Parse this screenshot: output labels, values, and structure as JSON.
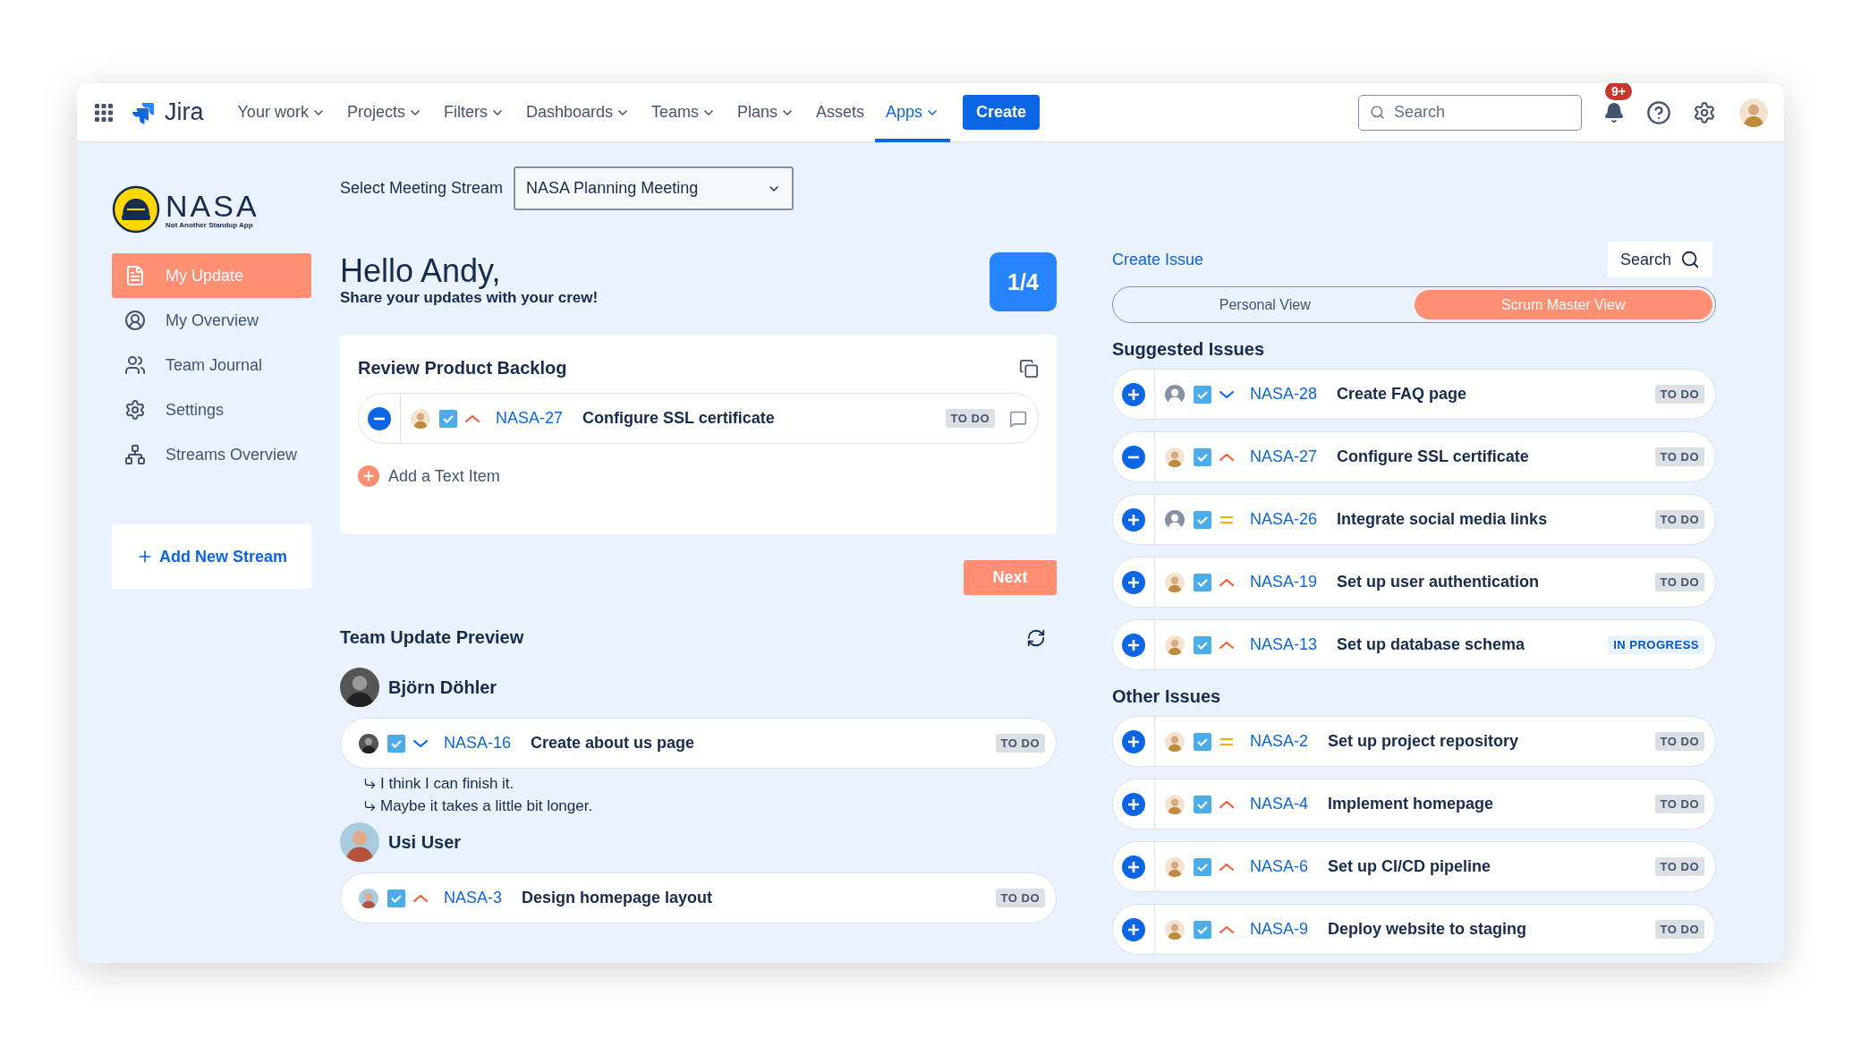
{
  "nav": {
    "product": "Jira",
    "items": [
      {
        "label": "Your work",
        "dropdown": true,
        "selected": false
      },
      {
        "label": "Projects",
        "dropdown": true,
        "selected": false
      },
      {
        "label": "Filters",
        "dropdown": true,
        "selected": false
      },
      {
        "label": "Dashboards",
        "dropdown": true,
        "selected": false
      },
      {
        "label": "Teams",
        "dropdown": true,
        "selected": false
      },
      {
        "label": "Plans",
        "dropdown": true,
        "selected": false
      },
      {
        "label": "Assets",
        "dropdown": false,
        "selected": false
      },
      {
        "label": "Apps",
        "dropdown": true,
        "selected": true
      }
    ],
    "create": "Create",
    "search": {
      "placeholder": "Search"
    },
    "notifications": "9+"
  },
  "sidebar": {
    "logo": {
      "name": "NASA",
      "tagline": "Not Another Standup App"
    },
    "items": [
      {
        "label": "My Update",
        "selected": true
      },
      {
        "label": "My Overview",
        "selected": false
      },
      {
        "label": "Team Journal",
        "selected": false
      },
      {
        "label": "Settings",
        "selected": false
      },
      {
        "label": "Streams Overview",
        "selected": false
      }
    ],
    "add_stream": "Add New Stream"
  },
  "main": {
    "stream_label": "Select Meeting Stream",
    "stream_value": "NASA Planning Meeting",
    "greeting": "Hello Andy,",
    "subtitle": "Share your updates with your crew!",
    "progress": "1/4",
    "card": {
      "title": "Review Product Backlog",
      "issues": [
        {
          "action": {
            "kind": "remove"
          },
          "avatar": {
            "kind": "person"
          },
          "priority": {
            "kind": "high"
          },
          "key": "NASA-27",
          "title": "Configure SSL certificate",
          "status": {
            "label": "TO DO",
            "kind": "todo"
          }
        }
      ],
      "add_text": "Add a Text Item"
    },
    "next": "Next",
    "preview": {
      "title": "Team Update Preview",
      "members": [
        {
          "name": "Björn Döhler",
          "avatar": {
            "kind": "dark"
          },
          "issues": [
            {
              "avatar": {
                "kind": "dark"
              },
              "priority": {
                "kind": "low"
              },
              "key": "NASA-16",
              "title": "Create about us page",
              "status": {
                "label": "TO DO",
                "kind": "todo"
              }
            }
          ],
          "notes": [
            "I think I can finish it.",
            "Maybe it takes a little bit longer."
          ]
        },
        {
          "name": "Usi User",
          "avatar": {
            "kind": "light"
          },
          "issues": [
            {
              "avatar": {
                "kind": "light"
              },
              "priority": {
                "kind": "high"
              },
              "key": "NASA-3",
              "title": "Design homepage layout",
              "status": {
                "label": "TO DO",
                "kind": "todo"
              }
            }
          ]
        }
      ]
    }
  },
  "panel": {
    "create_issue": "Create Issue",
    "search": "Search",
    "views": [
      {
        "label": "Personal View",
        "selected": false
      },
      {
        "label": "Scrum Master View",
        "selected": true
      }
    ],
    "sections": [
      {
        "title": "Suggested Issues",
        "issues": [
          {
            "action": {
              "kind": "add"
            },
            "avatar": {
              "kind": "placeholder"
            },
            "priority": {
              "kind": "low"
            },
            "key": "NASA-28",
            "title": "Create FAQ page",
            "status": {
              "label": "TO DO",
              "kind": "todo"
            }
          },
          {
            "action": {
              "kind": "remove"
            },
            "avatar": {
              "kind": "person"
            },
            "priority": {
              "kind": "high"
            },
            "key": "NASA-27",
            "title": "Configure SSL certificate",
            "status": {
              "label": "TO DO",
              "kind": "todo"
            }
          },
          {
            "action": {
              "kind": "add"
            },
            "avatar": {
              "kind": "placeholder"
            },
            "priority": {
              "kind": "medium"
            },
            "key": "NASA-26",
            "title": "Integrate social media links",
            "status": {
              "label": "TO DO",
              "kind": "todo"
            }
          },
          {
            "action": {
              "kind": "add"
            },
            "avatar": {
              "kind": "person"
            },
            "priority": {
              "kind": "high"
            },
            "key": "NASA-19",
            "title": "Set up user authentication",
            "status": {
              "label": "TO DO",
              "kind": "todo"
            }
          },
          {
            "action": {
              "kind": "add"
            },
            "avatar": {
              "kind": "person"
            },
            "priority": {
              "kind": "high"
            },
            "key": "NASA-13",
            "title": "Set up database schema",
            "status": {
              "label": "IN PROGRESS",
              "kind": "progress"
            }
          }
        ]
      },
      {
        "title": "Other Issues",
        "issues": [
          {
            "action": {
              "kind": "add"
            },
            "avatar": {
              "kind": "person"
            },
            "priority": {
              "kind": "medium"
            },
            "key": "NASA-2",
            "title": "Set up project repository",
            "status": {
              "label": "TO DO",
              "kind": "todo"
            }
          },
          {
            "action": {
              "kind": "add"
            },
            "avatar": {
              "kind": "person"
            },
            "priority": {
              "kind": "high"
            },
            "key": "NASA-4",
            "title": "Implement homepage",
            "status": {
              "label": "TO DO",
              "kind": "todo"
            }
          },
          {
            "action": {
              "kind": "add"
            },
            "avatar": {
              "kind": "person"
            },
            "priority": {
              "kind": "high"
            },
            "key": "NASA-6",
            "title": "Set up CI/CD pipeline",
            "status": {
              "label": "TO DO",
              "kind": "todo"
            }
          },
          {
            "action": {
              "kind": "add"
            },
            "avatar": {
              "kind": "person"
            },
            "priority": {
              "kind": "high"
            },
            "key": "NASA-9",
            "title": "Deploy website to staging",
            "status": {
              "label": "TO DO",
              "kind": "todo"
            }
          }
        ]
      }
    ]
  }
}
